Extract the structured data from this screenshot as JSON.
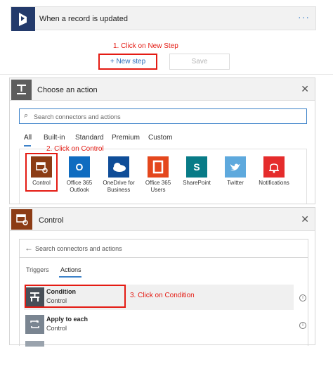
{
  "trigger": {
    "title": "When a record is updated",
    "more_label": "···",
    "brand_color": "#233a6b"
  },
  "annotations": {
    "step1": "1. Click on New Step",
    "step2": "2. Click on Control",
    "step3": "3. Click on Condition",
    "color": "#e41b13"
  },
  "buttons": {
    "new_step": "+ New step",
    "save": "Save"
  },
  "choose_action": {
    "title": "Choose an action",
    "close": "✕",
    "search_placeholder": "Search connectors and actions",
    "tabs": [
      "All",
      "Built-in",
      "Standard",
      "Premium",
      "Custom"
    ],
    "connectors": [
      {
        "label": "Control",
        "icon": "control-icon",
        "color": "#8c3c15"
      },
      {
        "label": "Office 365 Outlook",
        "icon": "outlook-icon",
        "color": "#0f6cc0"
      },
      {
        "label": "OneDrive for Business",
        "icon": "onedrive-icon",
        "color": "#0f4d98"
      },
      {
        "label": "Office 365 Users",
        "icon": "office-icon",
        "color": "#e4471d"
      },
      {
        "label": "SharePoint",
        "icon": "sharepoint-icon",
        "color": "#087b87"
      },
      {
        "label": "Twitter",
        "icon": "twitter-icon",
        "color": "#5ea9dd"
      },
      {
        "label": "Notifications",
        "icon": "bell-icon",
        "color": "#e52c2c"
      }
    ]
  },
  "control_panel": {
    "title": "Control",
    "close": "✕",
    "search_placeholder": "Search connectors and actions",
    "tabs": [
      "Triggers",
      "Actions"
    ],
    "operations": [
      {
        "name": "Condition",
        "sub": "Control",
        "icon": "condition-icon",
        "color": "#484f58"
      },
      {
        "name": "Apply to each",
        "sub": "Control",
        "icon": "loop-icon",
        "color": "#7a8591"
      }
    ],
    "info": "i"
  }
}
